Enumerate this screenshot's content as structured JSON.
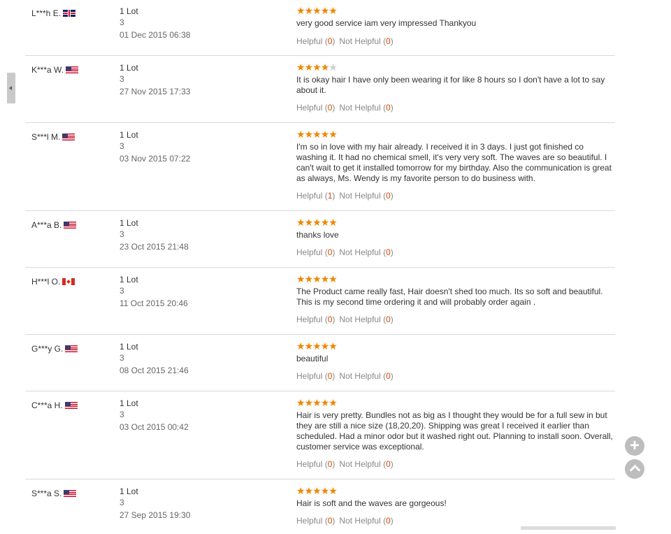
{
  "colors": {
    "star": "#f08600",
    "count": "#d04a02",
    "divider": "#d9d9d9"
  },
  "icons": {
    "side_tab": "caret-left-icon",
    "zoom": "plus-icon",
    "scroll_top": "chevron-up-icon"
  },
  "reviews": [
    {
      "user": "L***h E.",
      "country": "uk",
      "lot": "1 Lot",
      "qty": "3",
      "date": "01 Dec 2015 06:38",
      "rating": 5,
      "text": "very good service iam very impressed Thankyou",
      "helpful_label": "Helpful",
      "helpful_count": "0",
      "not_helpful_label": "Not Helpful",
      "not_helpful_count": "0"
    },
    {
      "user": "K***a W.",
      "country": "us",
      "lot": "1 Lot",
      "qty": "3",
      "date": "27 Nov 2015 17:33",
      "rating": 4,
      "text": "It is okay hair I have only been wearing it for like 8 hours so I don't have a lot to say about it.",
      "helpful_label": "Helpful",
      "helpful_count": "0",
      "not_helpful_label": "Not Helpful",
      "not_helpful_count": "0"
    },
    {
      "user": "S***l M.",
      "country": "us",
      "lot": "1 Lot",
      "qty": "3",
      "date": "03 Nov 2015 07:22",
      "rating": 5,
      "text": "I'm so in love with my hair already. I received it in 3 days. I just got finished co washing it. It had no chemical smell, it's very very soft. The waves are so beautiful. I can't wait to get it installed tomorrow for my birthday. Also the communication is great as always, Ms. Wendy is my favorite person to do business with.",
      "helpful_label": "Helpful",
      "helpful_count": "1",
      "not_helpful_label": "Not Helpful",
      "not_helpful_count": "0"
    },
    {
      "user": "A***a B.",
      "country": "us",
      "lot": "1 Lot",
      "qty": "3",
      "date": "23 Oct 2015 21:48",
      "rating": 5,
      "text": "thanks love",
      "helpful_label": "Helpful",
      "helpful_count": "0",
      "not_helpful_label": "Not Helpful",
      "not_helpful_count": "0"
    },
    {
      "user": "H***l O.",
      "country": "ca",
      "lot": "1 Lot",
      "qty": "3",
      "date": "11 Oct 2015 20:46",
      "rating": 5,
      "text": "The Product came really fast, Hair doesn't shed too much. Its so soft and beautiful. This is my second time ordering it and will probably order again .",
      "helpful_label": "Helpful",
      "helpful_count": "0",
      "not_helpful_label": "Not Helpful",
      "not_helpful_count": "0"
    },
    {
      "user": "G***y G.",
      "country": "us",
      "lot": "1 Lot",
      "qty": "3",
      "date": "08 Oct 2015 21:46",
      "rating": 5,
      "text": "beautiful",
      "helpful_label": "Helpful",
      "helpful_count": "0",
      "not_helpful_label": "Not Helpful",
      "not_helpful_count": "0"
    },
    {
      "user": "C***a H.",
      "country": "us",
      "lot": "1 Lot",
      "qty": "3",
      "date": "03 Oct 2015 00:42",
      "rating": 5,
      "text": "Hair is very pretty. Bundles not as big as I thought they would be for a full sew in but they are still a nice size (18,20,20). Shipping was great I received it earlier than scheduled. Had a minor odor but it washed right out. Planning to install soon. Overall, customer service was exceptional.",
      "helpful_label": "Helpful",
      "helpful_count": "0",
      "not_helpful_label": "Not Helpful",
      "not_helpful_count": "0"
    },
    {
      "user": "S***a S.",
      "country": "us",
      "lot": "1 Lot",
      "qty": "3",
      "date": "27 Sep 2015 19:30",
      "rating": 5,
      "text": "Hair is soft and the waves are gorgeous!",
      "helpful_label": "Helpful",
      "helpful_count": "0",
      "not_helpful_label": "Not Helpful",
      "not_helpful_count": "0"
    }
  ]
}
